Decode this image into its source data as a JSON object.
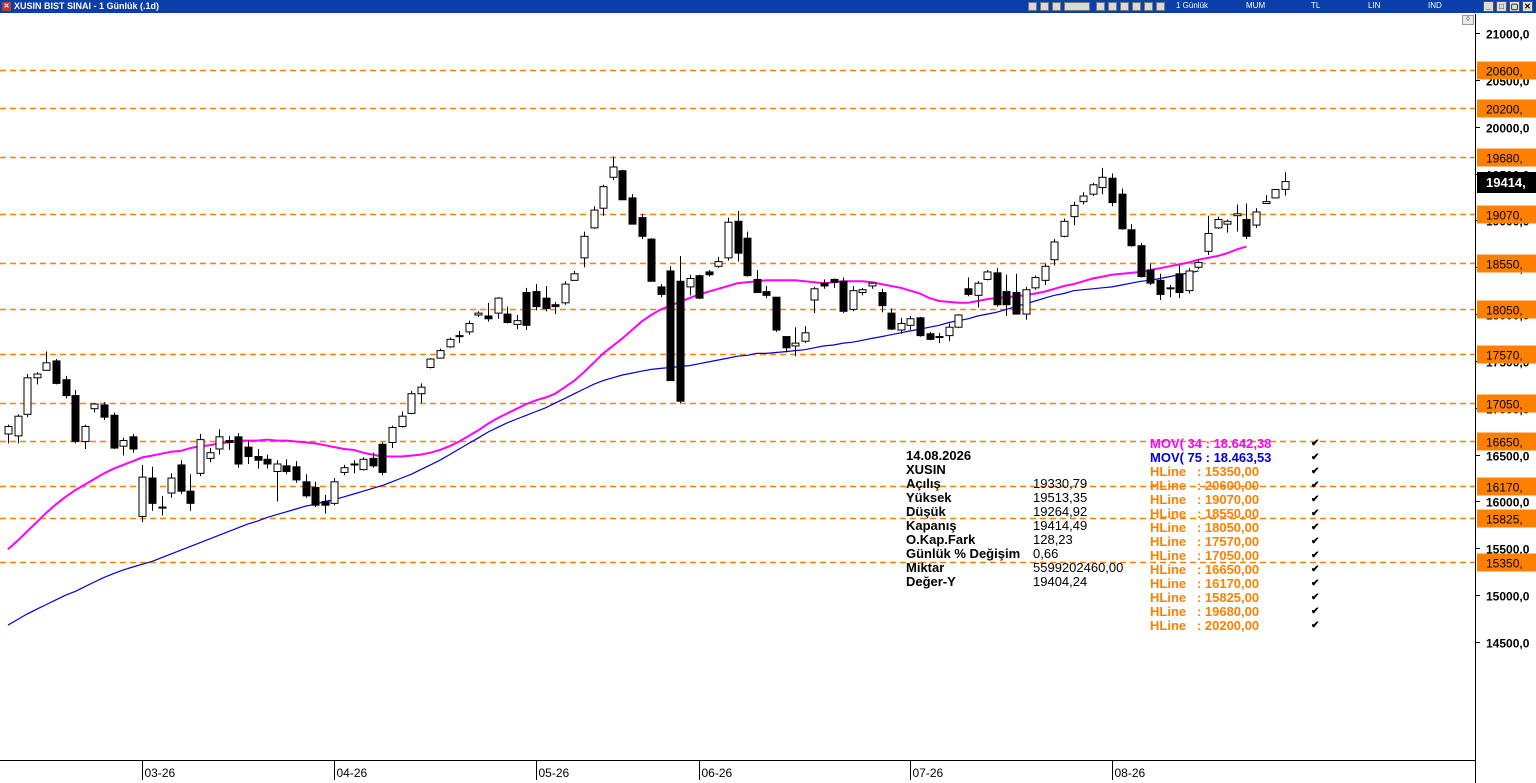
{
  "window": {
    "title": "XUSIN BIST SINAI - 1 Günlük (.1d)",
    "toolbar": {
      "period": "1 Günlük",
      "style": "MUM",
      "currency": "TL",
      "scale": "LIN",
      "indicator": "IND"
    }
  },
  "chart_data": {
    "type": "candlestick",
    "symbol": "XUSIN",
    "title": "XUSIN BIST SINAI - 1 Günlük (.1d)",
    "ylim": [
      14200,
      21300
    ],
    "y_ticks": [
      "21000,0",
      "20500,0",
      "20000,0",
      "19500,0",
      "19000,0",
      "18500,0",
      "18000,0",
      "17500,0",
      "17000,0",
      "16500,0",
      "16000,0",
      "15500,0",
      "15000,0",
      "14500,0"
    ],
    "y_tick_values": [
      21000,
      20500,
      20000,
      19500,
      19000,
      18500,
      18000,
      17500,
      17000,
      16500,
      16000,
      15500,
      15000,
      14500
    ],
    "x_ticks": [
      {
        "label": "03-26",
        "index": 14
      },
      {
        "label": "04-26",
        "index": 34
      },
      {
        "label": "05-26",
        "index": 55
      },
      {
        "label": "06-26",
        "index": 72
      },
      {
        "label": "07-26",
        "index": 94
      },
      {
        "label": "08-26",
        "index": 115
      }
    ],
    "last_price_label": "19414,",
    "hlines": [
      {
        "value": 20600,
        "label": "20600,"
      },
      {
        "value": 20200,
        "label": "20200,"
      },
      {
        "value": 19680,
        "label": "19680,"
      },
      {
        "value": 19070,
        "label": "19070,"
      },
      {
        "value": 18550,
        "label": "18550,"
      },
      {
        "value": 18050,
        "label": "18050,"
      },
      {
        "value": 17570,
        "label": "17570,"
      },
      {
        "value": 17050,
        "label": "17050,"
      },
      {
        "value": 16650,
        "label": "16650,"
      },
      {
        "value": 16170,
        "label": "16170,"
      },
      {
        "value": 15825,
        "label": "15825,"
      },
      {
        "value": 15350,
        "label": "15350,"
      }
    ],
    "candles": [
      [
        16720,
        16820,
        16620,
        16800
      ],
      [
        16700,
        16930,
        16620,
        16910
      ],
      [
        16930,
        17360,
        16900,
        17320
      ],
      [
        17320,
        17380,
        17250,
        17360
      ],
      [
        17400,
        17600,
        17400,
        17480
      ],
      [
        17500,
        17520,
        17250,
        17260
      ],
      [
        17300,
        17340,
        17100,
        17130
      ],
      [
        17130,
        17190,
        16620,
        16640
      ],
      [
        16640,
        16820,
        16560,
        16800
      ],
      [
        16990,
        17050,
        16950,
        17040
      ],
      [
        17030,
        17060,
        16870,
        16900
      ],
      [
        16920,
        16950,
        16560,
        16570
      ],
      [
        16590,
        16680,
        16490,
        16650
      ],
      [
        16690,
        16720,
        16520,
        16560
      ],
      [
        15840,
        16390,
        15780,
        16260
      ],
      [
        16250,
        16370,
        15900,
        15980
      ],
      [
        15940,
        16060,
        15850,
        15930
      ],
      [
        16090,
        16300,
        16040,
        16250
      ],
      [
        16390,
        16440,
        16080,
        16110
      ],
      [
        16110,
        16290,
        15900,
        15980
      ],
      [
        16300,
        16720,
        16270,
        16660
      ],
      [
        16460,
        16570,
        16420,
        16520
      ],
      [
        16560,
        16770,
        16500,
        16690
      ],
      [
        16650,
        16700,
        16550,
        16630
      ],
      [
        16690,
        16730,
        16360,
        16400
      ],
      [
        16580,
        16650,
        16400,
        16480
      ],
      [
        16480,
        16560,
        16350,
        16440
      ],
      [
        16450,
        16500,
        16350,
        16400
      ],
      [
        16320,
        16440,
        16000,
        16400
      ],
      [
        16380,
        16450,
        16290,
        16320
      ],
      [
        16370,
        16430,
        16200,
        16230
      ],
      [
        16210,
        16290,
        16040,
        16060
      ],
      [
        16150,
        16210,
        15940,
        15960
      ],
      [
        16000,
        16070,
        15870,
        15960
      ],
      [
        15980,
        16250,
        15960,
        16210
      ],
      [
        16310,
        16390,
        16280,
        16360
      ],
      [
        16400,
        16440,
        16300,
        16390
      ],
      [
        16340,
        16470,
        16330,
        16450
      ],
      [
        16460,
        16520,
        16360,
        16380
      ],
      [
        16610,
        16630,
        16280,
        16310
      ],
      [
        16630,
        16810,
        16570,
        16790
      ],
      [
        16800,
        16960,
        16790,
        16910
      ],
      [
        16940,
        17180,
        16930,
        17150
      ],
      [
        17150,
        17260,
        17050,
        17220
      ],
      [
        17430,
        17530,
        17420,
        17520
      ],
      [
        17530,
        17630,
        17530,
        17610
      ],
      [
        17650,
        17750,
        17640,
        17730
      ],
      [
        17760,
        17820,
        17690,
        17770
      ],
      [
        17810,
        17930,
        17780,
        17900
      ],
      [
        17990,
        18030,
        17970,
        18010
      ],
      [
        17980,
        18120,
        17920,
        17950
      ],
      [
        18010,
        18180,
        17950,
        18170
      ],
      [
        18000,
        18080,
        17900,
        17910
      ],
      [
        17890,
        17990,
        17840,
        17930
      ],
      [
        18230,
        18280,
        17830,
        17880
      ],
      [
        18240,
        18320,
        18040,
        18080
      ],
      [
        18170,
        18300,
        18030,
        18060
      ],
      [
        18100,
        18130,
        18000,
        18080
      ],
      [
        18120,
        18350,
        18100,
        18320
      ],
      [
        18360,
        18460,
        18360,
        18430
      ],
      [
        18600,
        18880,
        18500,
        18830
      ],
      [
        18920,
        19150,
        18910,
        19110
      ],
      [
        19130,
        19380,
        19050,
        19360
      ],
      [
        19460,
        19680,
        19430,
        19570
      ],
      [
        19530,
        19540,
        19220,
        19220
      ],
      [
        19240,
        19280,
        18960,
        18960
      ],
      [
        19030,
        19070,
        18800,
        18830
      ],
      [
        18800,
        18810,
        18350,
        18350
      ],
      [
        18290,
        18320,
        18180,
        18210
      ],
      [
        18460,
        18510,
        17290,
        17290
      ],
      [
        18350,
        18620,
        17050,
        17070
      ],
      [
        18290,
        18420,
        18200,
        18380
      ],
      [
        18410,
        18420,
        18160,
        18170
      ],
      [
        18450,
        18470,
        18400,
        18420
      ],
      [
        18510,
        18610,
        18490,
        18560
      ],
      [
        18600,
        19030,
        18570,
        18980
      ],
      [
        18990,
        19100,
        18560,
        18650
      ],
      [
        18810,
        18880,
        18400,
        18410
      ],
      [
        18370,
        18470,
        18230,
        18230
      ],
      [
        18240,
        18300,
        18170,
        18200
      ],
      [
        18180,
        18180,
        17810,
        17830
      ],
      [
        17760,
        17760,
        17590,
        17640
      ],
      [
        17660,
        17860,
        17550,
        17690
      ],
      [
        17710,
        17870,
        17690,
        17800
      ],
      [
        18150,
        18290,
        18010,
        18270
      ],
      [
        18330,
        18370,
        18270,
        18300
      ],
      [
        18370,
        18380,
        18280,
        18340
      ],
      [
        18350,
        18390,
        18010,
        18030
      ],
      [
        18050,
        18300,
        18030,
        18250
      ],
      [
        18230,
        18280,
        18200,
        18260
      ],
      [
        18300,
        18340,
        18270,
        18330
      ],
      [
        18230,
        18270,
        18020,
        18090
      ],
      [
        18010,
        18060,
        17830,
        17840
      ],
      [
        17830,
        17960,
        17790,
        17900
      ],
      [
        17880,
        17980,
        17830,
        17950
      ],
      [
        17960,
        17970,
        17760,
        17770
      ],
      [
        17790,
        17810,
        17720,
        17730
      ],
      [
        17760,
        17800,
        17690,
        17750
      ],
      [
        17770,
        17900,
        17710,
        17860
      ],
      [
        17860,
        18000,
        17850,
        17990
      ],
      [
        18270,
        18390,
        18190,
        18210
      ],
      [
        18200,
        18350,
        18070,
        18330
      ],
      [
        18370,
        18470,
        18360,
        18450
      ],
      [
        18440,
        18490,
        18080,
        18100
      ],
      [
        18240,
        18420,
        17980,
        18100
      ],
      [
        18230,
        18430,
        18000,
        18000
      ],
      [
        18000,
        18290,
        17940,
        18260
      ],
      [
        18280,
        18410,
        18260,
        18390
      ],
      [
        18360,
        18540,
        18310,
        18510
      ],
      [
        18580,
        18800,
        18520,
        18770
      ],
      [
        18830,
        19020,
        18820,
        18990
      ],
      [
        19040,
        19200,
        18950,
        19160
      ],
      [
        19200,
        19300,
        19170,
        19260
      ],
      [
        19280,
        19400,
        19260,
        19380
      ],
      [
        19350,
        19560,
        19280,
        19460
      ],
      [
        19450,
        19500,
        19150,
        19190
      ],
      [
        19280,
        19340,
        18900,
        18910
      ],
      [
        18900,
        18960,
        18720,
        18730
      ],
      [
        18730,
        18760,
        18390,
        18400
      ],
      [
        18470,
        18540,
        18310,
        18330
      ],
      [
        18360,
        18430,
        18150,
        18210
      ],
      [
        18280,
        18310,
        18180,
        18280
      ],
      [
        18430,
        18520,
        18170,
        18230
      ],
      [
        18250,
        18490,
        18220,
        18460
      ],
      [
        18500,
        18580,
        18480,
        18550
      ],
      [
        18670,
        19050,
        18630,
        18860
      ],
      [
        18920,
        19040,
        18910,
        19010
      ],
      [
        18960,
        19010,
        18870,
        18990
      ],
      [
        19050,
        19170,
        18880,
        19070
      ],
      [
        19010,
        19180,
        18800,
        18830
      ],
      [
        18950,
        19130,
        18920,
        19090
      ],
      [
        19180,
        19270,
        19180,
        19200
      ],
      [
        19240,
        19330,
        19260,
        19330
      ],
      [
        19330.79,
        19513.35,
        19264.92,
        19414.49
      ]
    ],
    "series": [
      {
        "name": "MOV( 34 : 18.642,38",
        "color": "#ff00ff",
        "values": [
          15490,
          15580,
          15680,
          15780,
          15880,
          15970,
          16050,
          16120,
          16180,
          16240,
          16300,
          16350,
          16390,
          16430,
          16470,
          16490,
          16510,
          16530,
          16540,
          16570,
          16590,
          16600,
          16620,
          16630,
          16650,
          16650,
          16650,
          16660,
          16650,
          16650,
          16640,
          16630,
          16620,
          16600,
          16580,
          16560,
          16550,
          16520,
          16500,
          16480,
          16480,
          16480,
          16490,
          16500,
          16520,
          16550,
          16590,
          16640,
          16700,
          16760,
          16830,
          16890,
          16940,
          16990,
          17040,
          17080,
          17110,
          17150,
          17220,
          17290,
          17380,
          17480,
          17580,
          17660,
          17740,
          17830,
          17920,
          17990,
          18050,
          18090,
          18130,
          18170,
          18210,
          18240,
          18270,
          18300,
          18330,
          18340,
          18350,
          18360,
          18360,
          18360,
          18360,
          18350,
          18340,
          18330,
          18340,
          18350,
          18350,
          18350,
          18340,
          18320,
          18300,
          18280,
          18250,
          18220,
          18170,
          18140,
          18130,
          18120,
          18120,
          18140,
          18160,
          18170,
          18180,
          18190,
          18200,
          18220,
          18240,
          18270,
          18300,
          18320,
          18350,
          18380,
          18400,
          18420,
          18430,
          18440,
          18450,
          18470,
          18490,
          18510,
          18530,
          18550,
          18580,
          18600,
          18620,
          18650,
          18690,
          18720
        ]
      },
      {
        "name": "MOV( 75 : 18.463,53",
        "color": "#0000dd",
        "values": [
          14680,
          14740,
          14800,
          14850,
          14900,
          14950,
          15000,
          15040,
          15090,
          15140,
          15190,
          15230,
          15270,
          15300,
          15330,
          15360,
          15400,
          15440,
          15480,
          15520,
          15560,
          15600,
          15640,
          15680,
          15720,
          15760,
          15790,
          15830,
          15860,
          15890,
          15920,
          15950,
          15970,
          16000,
          16020,
          16050,
          16080,
          16110,
          16140,
          16170,
          16210,
          16250,
          16290,
          16340,
          16390,
          16440,
          16500,
          16560,
          16620,
          16680,
          16740,
          16790,
          16840,
          16880,
          16920,
          16960,
          17000,
          17050,
          17100,
          17150,
          17200,
          17250,
          17290,
          17320,
          17350,
          17370,
          17390,
          17410,
          17420,
          17430,
          17440,
          17450,
          17470,
          17490,
          17510,
          17530,
          17550,
          17560,
          17580,
          17580,
          17590,
          17600,
          17610,
          17620,
          17640,
          17660,
          17670,
          17690,
          17700,
          17720,
          17740,
          17760,
          17780,
          17800,
          17820,
          17840,
          17860,
          17880,
          17910,
          17930,
          17950,
          17980,
          18000,
          18020,
          18050,
          18080,
          18110,
          18140,
          18170,
          18200,
          18220,
          18250,
          18260,
          18270,
          18280,
          18290,
          18310,
          18330,
          18350,
          18360,
          18380,
          18400,
          18420,
          18440,
          18460
        ]
      }
    ]
  },
  "legend": [
    {
      "text": "MOV( 34 : 18.642,38",
      "color": "#ff00ff",
      "check": "✔"
    },
    {
      "text": "MOV( 75 : 18.463,53",
      "color": "#0000dd",
      "check": "✔"
    },
    {
      "text": "HLine   : 15350,00",
      "color": "#ff8000",
      "check": "✔"
    },
    {
      "text": "HLine   : 20600,00",
      "color": "#ff8000",
      "check": "✔"
    },
    {
      "text": "HLine   : 19070,00",
      "color": "#ff8000",
      "check": "✔"
    },
    {
      "text": "HLine   : 18550,00",
      "color": "#ff8000",
      "check": "✔"
    },
    {
      "text": "HLine   : 18050,00",
      "color": "#ff8000",
      "check": "✔"
    },
    {
      "text": "HLine   : 17570,00",
      "color": "#ff8000",
      "check": "✔"
    },
    {
      "text": "HLine   : 17050,00",
      "color": "#ff8000",
      "check": "✔"
    },
    {
      "text": "HLine   : 16650,00",
      "color": "#ff8000",
      "check": "✔"
    },
    {
      "text": "HLine   : 16170,00",
      "color": "#ff8000",
      "check": "✔"
    },
    {
      "text": "HLine   : 15825,00",
      "color": "#ff8000",
      "check": "✔"
    },
    {
      "text": "HLine   : 19680,00",
      "color": "#ff8000",
      "check": "✔"
    },
    {
      "text": "HLine   : 20200,00",
      "color": "#ff8000",
      "check": "✔"
    }
  ],
  "info_panel": {
    "date": "14.08.2026",
    "symbol": "XUSIN",
    "rows": [
      {
        "label": "Açılış",
        "value": "19330,79"
      },
      {
        "label": "Yüksek",
        "value": "19513,35"
      },
      {
        "label": "Düşük",
        "value": "19264,92"
      },
      {
        "label": "Kapanış",
        "value": "19414,49"
      },
      {
        "label": "O.Kap.Fark",
        "value": "128,23"
      },
      {
        "label": "Günlük % Değişim",
        "value": "0,66"
      },
      {
        "label": "Miktar",
        "value": "5599202460,00"
      },
      {
        "label": "Değer-Y",
        "value": "19404,24"
      }
    ]
  },
  "colors": {
    "hline": "#ff8000",
    "up_candle": "#ffffff",
    "down_candle": "#000000",
    "last_price_bg": "#000000"
  }
}
